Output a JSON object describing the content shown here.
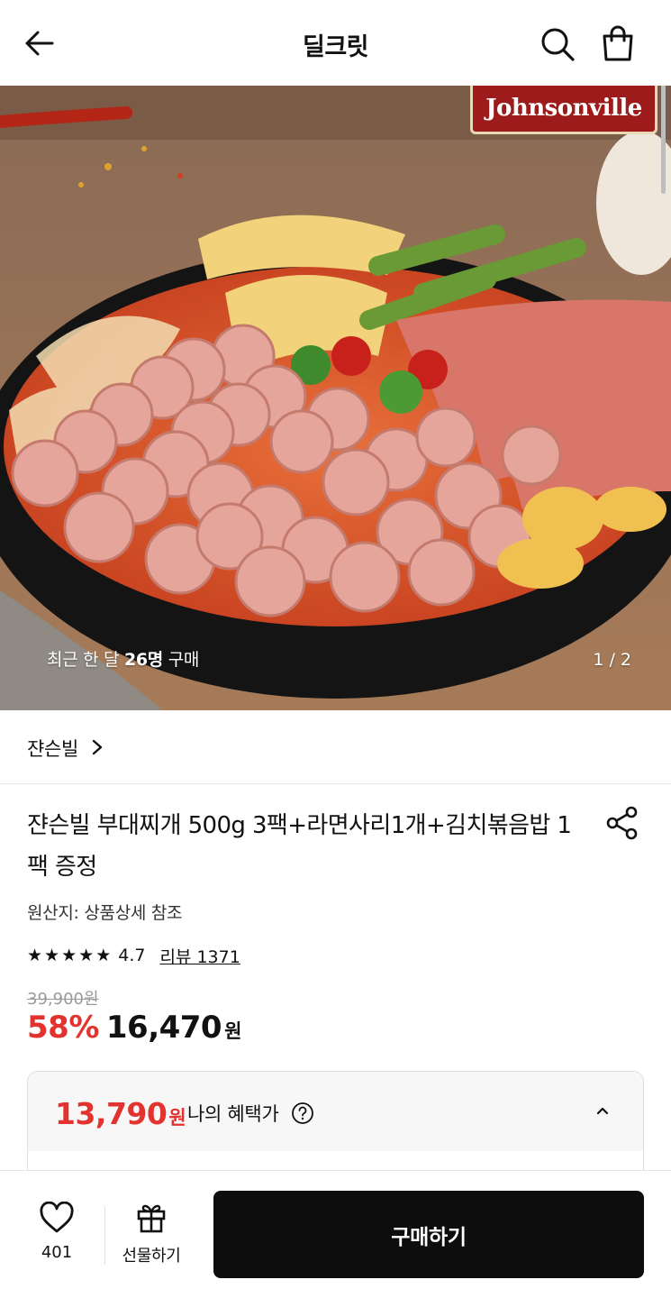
{
  "header": {
    "title": "딜크릿",
    "icons": [
      "back-arrow-icon",
      "search-icon",
      "shopping-bag-icon"
    ]
  },
  "hero": {
    "logo_text": "Johnsonville",
    "buyers_prefix": "최근 한 달 ",
    "buyers_count": "26명",
    "buyers_suffix": " 구매",
    "pager": "1 / 2"
  },
  "brand": {
    "name": "쟌슨빌"
  },
  "product": {
    "name": "쟌슨빌 부대찌개 500g 3팩+라면사리1개+김치볶음밥 1팩 증정",
    "origin": "원산지: 상품상세 참조",
    "rating": 4.7,
    "rating_text": "4.7",
    "reviews_label": "리뷰 1371",
    "original_price": "39,900원",
    "discount": "58%",
    "price": "16,470",
    "price_unit": "원"
  },
  "benefit": {
    "price": "13,790",
    "price_unit": "원",
    "label": "나의 혜택가"
  },
  "bottom_bar": {
    "like_count": "401",
    "gift_label": "선물하기",
    "buy_label": "구매하기"
  },
  "colors": {
    "accent_red": "#e2332f",
    "buy_button": "#0d0d0d"
  }
}
